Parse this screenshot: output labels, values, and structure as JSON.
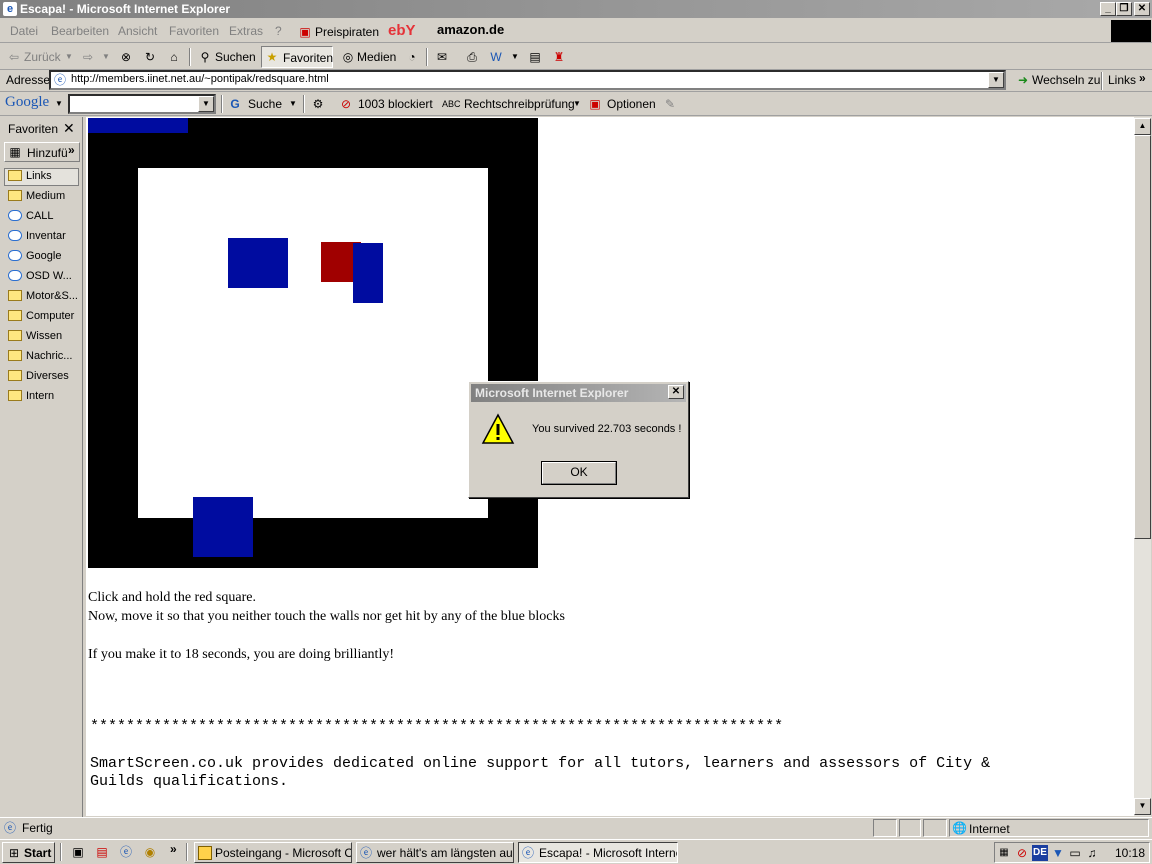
{
  "window": {
    "title": "Escapa! - Microsoft Internet Explorer"
  },
  "menu": [
    "Datei",
    "Bearbeiten",
    "Ansicht",
    "Favoriten",
    "Extras",
    "?"
  ],
  "menu_links": {
    "preispiraten": "Preispiraten",
    "ebay": "ebY",
    "amazon": "amazon.de"
  },
  "toolbar": {
    "back": "Zurück",
    "search": "Suchen",
    "favorites": "Favoriten",
    "media": "Medien"
  },
  "address": {
    "label": "Adresse",
    "url": "http://members.iinet.net.au/~pontipak/redsquare.html",
    "go": "Wechseln zu",
    "links": "Links"
  },
  "googlebar": {
    "logo": "Google",
    "search": "Suche",
    "blocked": "1003 blockiert",
    "spell": "Rechtschreibprüfung",
    "options": "Optionen"
  },
  "favorites": {
    "title": "Favoriten",
    "add": "Hinzufü",
    "items": [
      "Links",
      "Medium",
      "CALL",
      "Inventar",
      "Google",
      "OSD W...",
      "Motor&S...",
      "Computer",
      "Wissen",
      "Nachric...",
      "Diverses",
      "Intern"
    ]
  },
  "page": {
    "line1": "Click and hold the red square.",
    "line2": "Now, move it so that you neither touch the walls nor get hit by any of the blue blocks",
    "line3": "If you make it to 18 seconds, you are doing brilliantly!",
    "stars": "*****************************************************************************",
    "smart1": "SmartScreen.co.uk provides dedicated online support for all tutors, learners and assessors of City &",
    "smart2": "Guilds qualifications."
  },
  "dialog": {
    "title": "Microsoft Internet Explorer",
    "message": "You survived 22.703 seconds !",
    "ok": "OK"
  },
  "status": {
    "text": "Fertig",
    "zone": "Internet"
  },
  "taskbar": {
    "start": "Start",
    "tasks": [
      "Posteingang - Microsoft O...",
      "wer hält's am längsten aus...",
      "Escapa! - Microsoft Interne..."
    ],
    "clock": "10:18",
    "lang": "DE"
  }
}
